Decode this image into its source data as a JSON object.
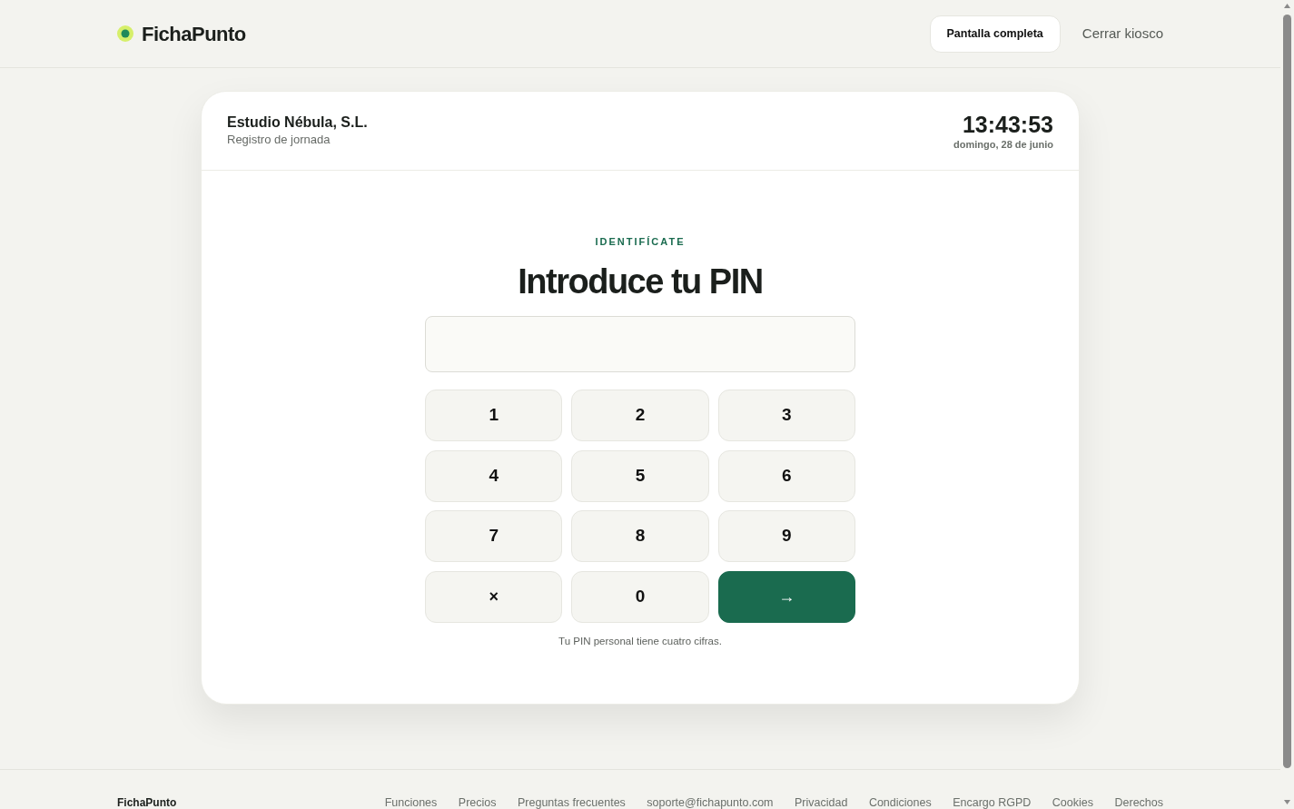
{
  "header": {
    "brand": "FichaPunto",
    "fullscreen_button": "Pantalla completa",
    "close_link": "Cerrar kiosco"
  },
  "card": {
    "company": "Estudio Nébula, S.L.",
    "subtitle": "Registro de jornada",
    "time": "13:43:53",
    "date": "domingo, 28 de junio",
    "eyebrow": "IDENTIFÍCATE",
    "heading": "Introduce tu PIN",
    "keys": [
      {
        "label": "1",
        "kind": "digit"
      },
      {
        "label": "2",
        "kind": "digit"
      },
      {
        "label": "3",
        "kind": "digit"
      },
      {
        "label": "4",
        "kind": "digit"
      },
      {
        "label": "5",
        "kind": "digit"
      },
      {
        "label": "6",
        "kind": "digit"
      },
      {
        "label": "7",
        "kind": "digit"
      },
      {
        "label": "8",
        "kind": "digit"
      },
      {
        "label": "9",
        "kind": "digit"
      },
      {
        "label": "×",
        "kind": "clear"
      },
      {
        "label": "0",
        "kind": "digit"
      },
      {
        "label": "→",
        "kind": "submit"
      }
    ],
    "hint": "Tu PIN personal tiene cuatro cifras."
  },
  "footer": {
    "brand": "FichaPunto",
    "links": [
      "Funciones",
      "Precios",
      "Preguntas frecuentes",
      "soporte@fichapunto.com",
      "Privacidad",
      "Condiciones",
      "Encargo RGPD",
      "Cookies",
      "Derechos"
    ]
  }
}
